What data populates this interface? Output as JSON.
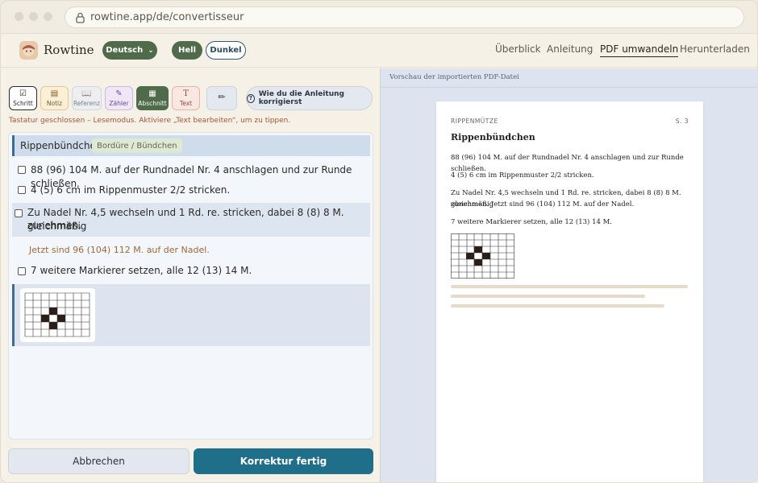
{
  "browser": {
    "url": "rowtine.app/de/convertisseur"
  },
  "app": {
    "brand": "Rowtine",
    "language": "Deutsch",
    "theme": {
      "light": "Hell",
      "dark": "Dunkel"
    },
    "nav": [
      "Überblick",
      "Anleitung",
      "PDF umwandeln",
      "Herunterladen"
    ],
    "active_nav": "PDF umwandeln"
  },
  "toolbar": {
    "tools": [
      {
        "label": "Schritt",
        "icon": "checkbox-icon"
      },
      {
        "label": "Notiz",
        "icon": "note-icon"
      },
      {
        "label": "Referenz",
        "icon": "book-icon"
      },
      {
        "label": "Zähler",
        "icon": "counter-icon"
      },
      {
        "label": "Abschnitt",
        "icon": "section-icon"
      },
      {
        "label": "Text",
        "icon": "text-icon"
      }
    ],
    "edit_icon": "pencil-icon",
    "help_button": "Wie du die Anleitung korrigierst"
  },
  "status": "Tastatur geschlossen – Lesemodus. Aktiviere „Text bearbeiten“, um zu tippen.",
  "editor": {
    "section_title": "Rippenbündchen",
    "section_tag": "Bordüre / Bündchen",
    "steps": [
      "88 (96) 104 M. auf der Rundnadel Nr. 4 anschlagen und zur Runde schließen.",
      "4 (5) 6 cm im Rippenmuster 2/2 stricken.",
      "Zu Nadel Nr. 4,5 wechseln und 1 Rd. re. stricken, dabei 8 (8) 8 M. gleichmäßig",
      "zunehmen."
    ],
    "note": "Jetzt sind 96 (104) 112 M. auf der Nadel.",
    "step_last": "7 weitere Markierer setzen, alle 12 (13) 14 M."
  },
  "actions": {
    "cancel": "Abbrechen",
    "done": "Korrektur fertig"
  },
  "preview": {
    "header": "Vorschau der importierten PDF-Datei",
    "kicker": "RIPPENMÜTZE",
    "page": "S. 3",
    "title": "Rippenbündchen",
    "lines": [
      "88 (96) 104 M. auf der Rundnadel Nr. 4 anschlagen und zur Runde schließen.",
      "4 (5) 6 cm im Rippenmuster 2/2 stricken.",
      "Zu Nadel Nr. 4,5 wechseln und 1 Rd. re. stricken, dabei 8 (8) 8 M. gleichmäßig",
      "zunehmen. Jetzt sind 96 (104) 112 M. auf der Nadel.",
      "7 weitere Markierer setzen, alle 12 (13) 14 M."
    ]
  },
  "colors": {
    "accent_green": "#4f6b4a",
    "primary_blue": "#1f6f8b",
    "section_blue": "#3f6a92"
  }
}
